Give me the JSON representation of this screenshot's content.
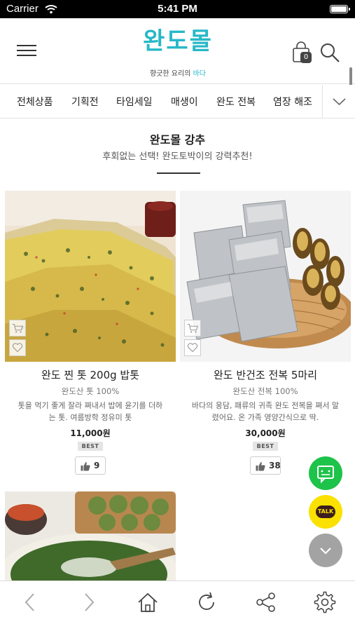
{
  "status_bar": {
    "carrier": "Carrier",
    "time": "5:41 PM"
  },
  "header": {
    "logo_text": "완도몰",
    "tagline_prefix": "향긋한 요리의 ",
    "tagline_accent": "바다",
    "cart_count": "0",
    "accent_color": "#27b8c8"
  },
  "category_nav": {
    "items": [
      "전체상품",
      "기획전",
      "타임세일",
      "매생이",
      "완도 전복",
      "염장 해조"
    ]
  },
  "section": {
    "title": "완도몰 강추",
    "subtitle": "후회없는 선택! 완도토박이의 강력추천!"
  },
  "products": [
    {
      "name": "완도 찐 톳 200g 밥톳",
      "sub": "완도산 톳 100%",
      "desc_line1": "톳을 먹기 좋게 잘라 쪄내서 밥에 윤기를 더하",
      "desc_line2": "는 톳. 여름방학 정유미 톳",
      "price": "11,000원",
      "badge": "BEST",
      "likes": "9"
    },
    {
      "name": "완도 반건조 전복 5마리",
      "sub": "완도산 전복 100%",
      "desc_line1": "바다의 웅담, 패류의 귀족 완도 전복을 쪄서 말",
      "desc_line2": "렸어요. 온 가족 영양간식으로 딱.",
      "price": "30,000원",
      "badge": "BEST",
      "likes": "38"
    },
    {
      "name": "",
      "image": "matcha-rice-dish"
    }
  ],
  "floating": {
    "talk_label": "TALK"
  },
  "toolbar": {
    "icons": [
      "back-icon",
      "forward-icon",
      "home-icon",
      "refresh-icon",
      "share-icon",
      "settings-icon"
    ]
  }
}
